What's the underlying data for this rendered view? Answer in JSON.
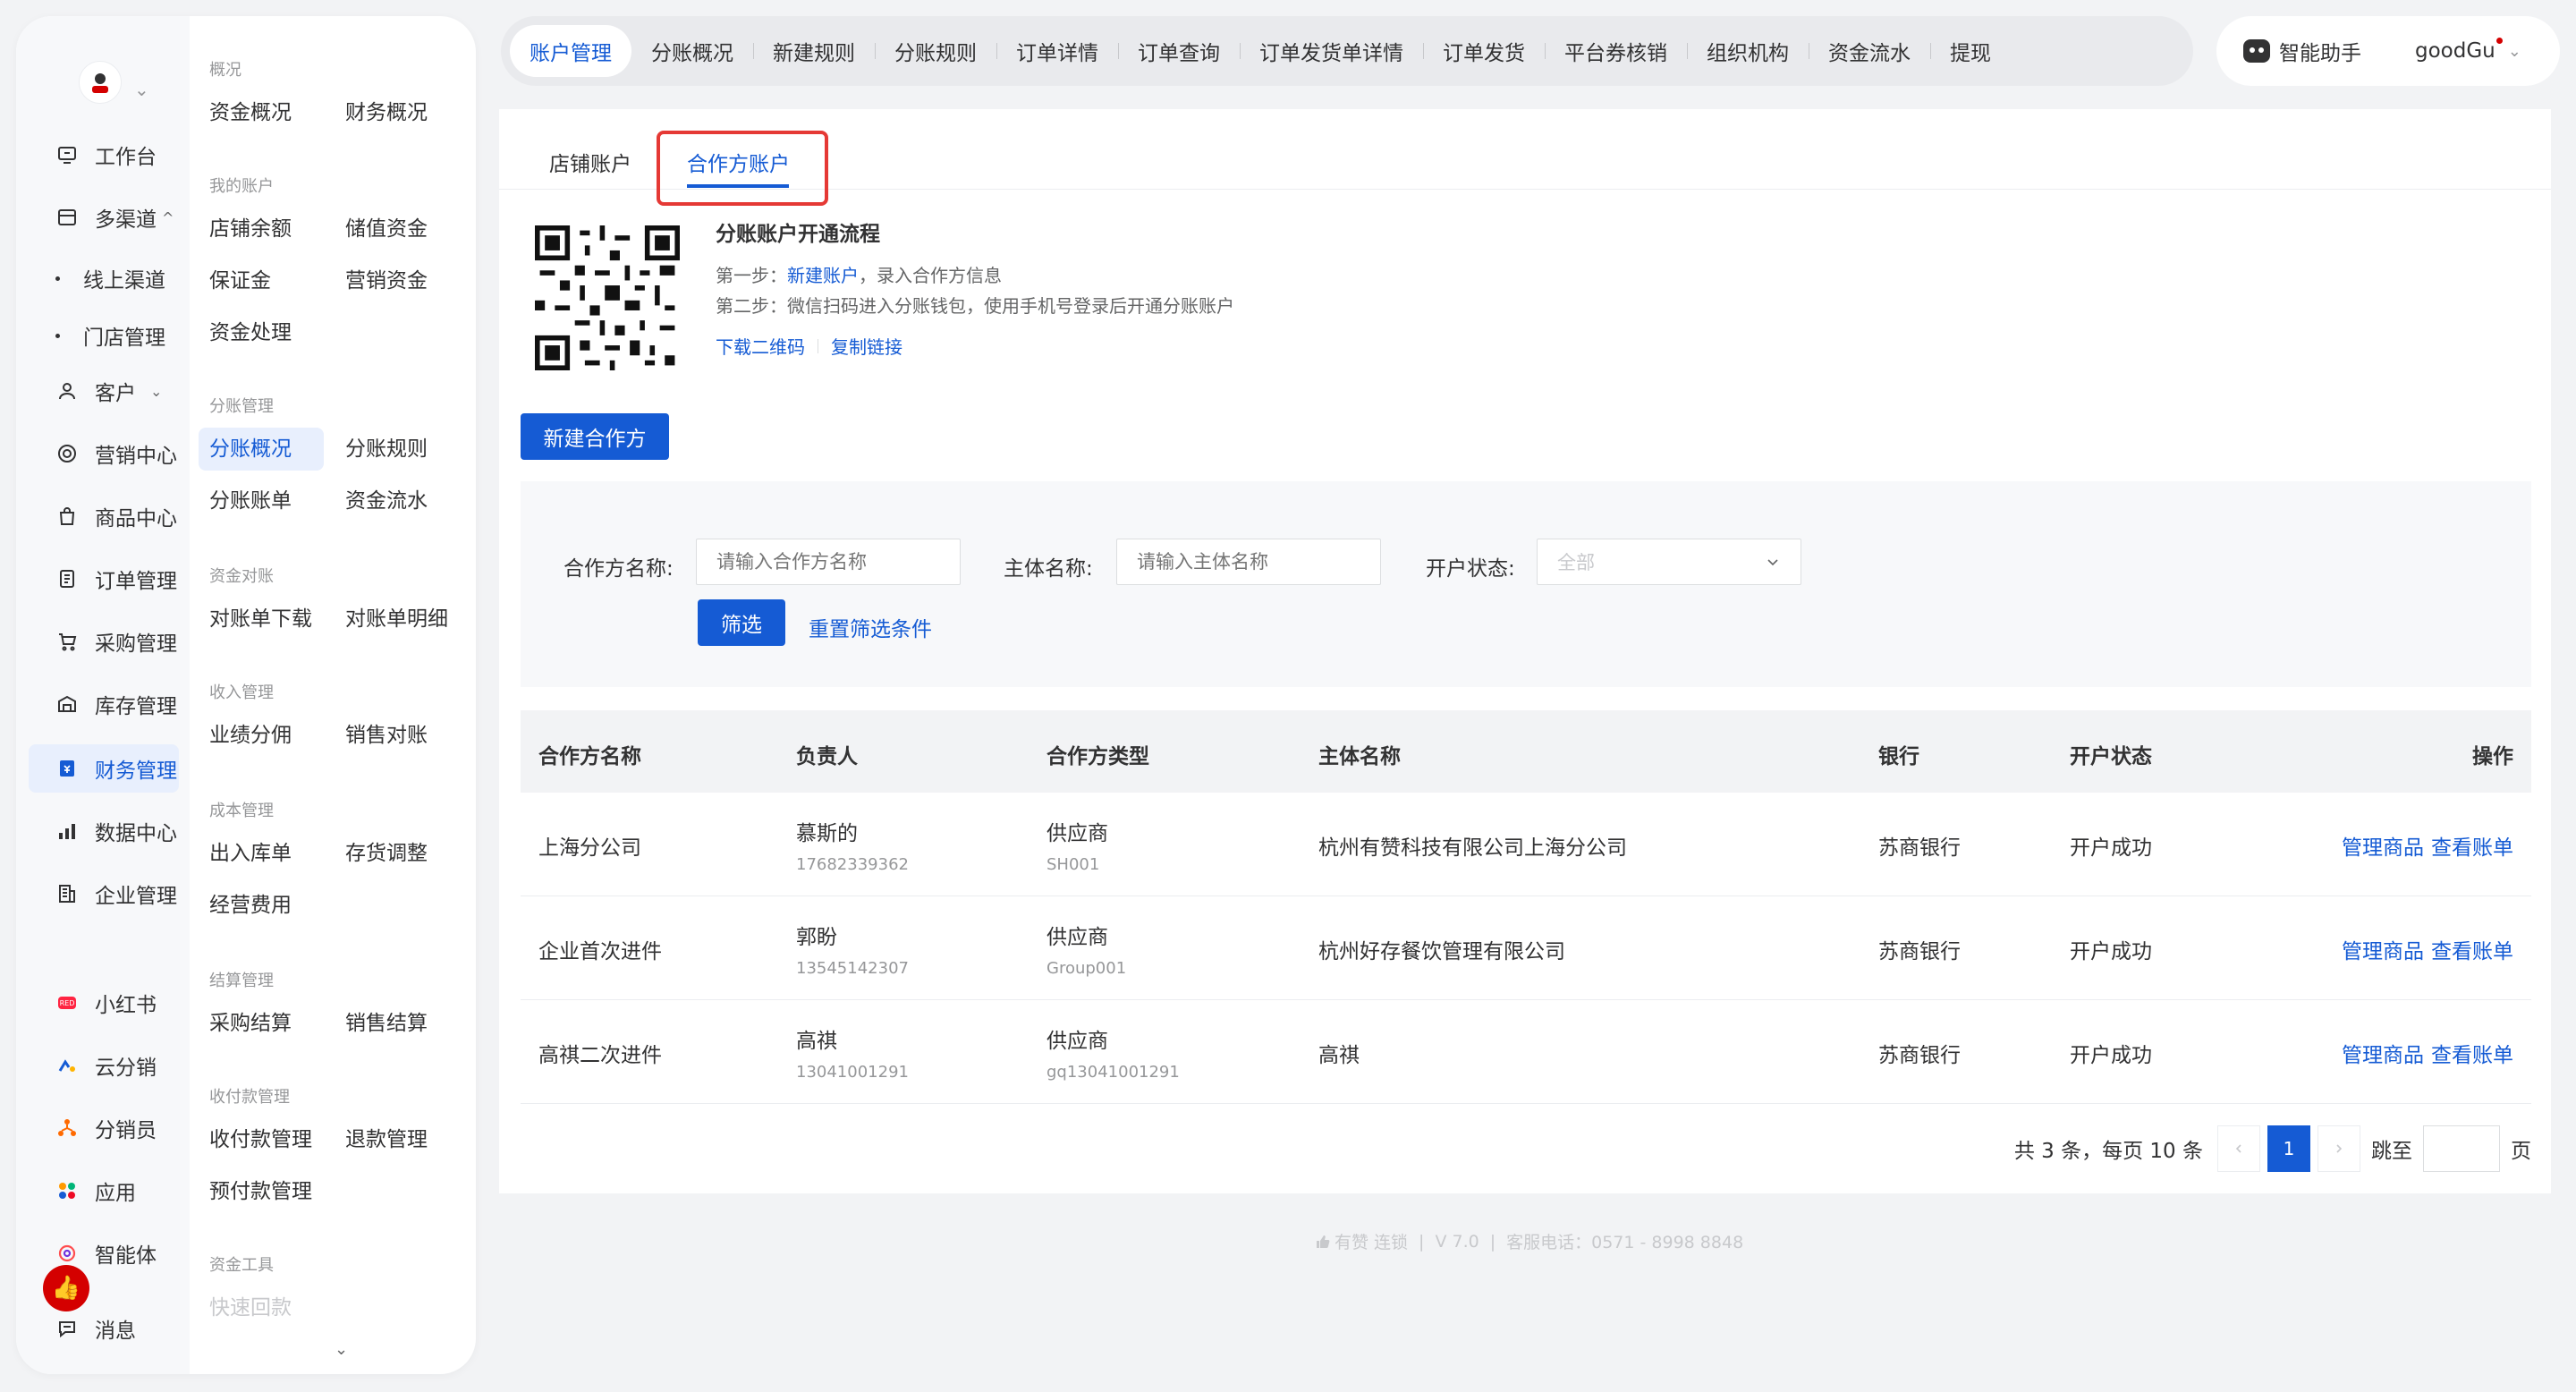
{
  "rail": {
    "items": [
      {
        "label": "工作台",
        "icon": "desk-icon"
      },
      {
        "label": "多渠道",
        "icon": "channel-icon"
      },
      {
        "label": "线上渠道"
      },
      {
        "label": "门店管理"
      },
      {
        "label": "客户",
        "icon": "user-icon"
      },
      {
        "label": "营销中心",
        "icon": "marketing-icon"
      },
      {
        "label": "商品中心",
        "icon": "bag-icon"
      },
      {
        "label": "订单管理",
        "icon": "order-icon"
      },
      {
        "label": "采购管理",
        "icon": "cart-icon"
      },
      {
        "label": "库存管理",
        "icon": "warehouse-icon"
      },
      {
        "label": "财务管理",
        "icon": "finance-icon"
      },
      {
        "label": "数据中心",
        "icon": "chart-icon"
      },
      {
        "label": "企业管理",
        "icon": "building-icon"
      },
      {
        "label": "小红书",
        "icon": "xiaohongshu-icon"
      },
      {
        "label": "云分销",
        "icon": "cloud-icon"
      },
      {
        "label": "分销员",
        "icon": "distributor-icon"
      },
      {
        "label": "应用",
        "icon": "apps-icon"
      },
      {
        "label": "智能体",
        "icon": "agent-icon"
      },
      {
        "label": "消息",
        "icon": "message-icon"
      }
    ],
    "caret_up": "^",
    "caret_down": "⌄"
  },
  "subnav": {
    "groups": [
      {
        "title": "概况",
        "links": [
          "资金概况",
          "财务概况"
        ]
      },
      {
        "title": "我的账户",
        "links": [
          "店铺余额",
          "储值资金",
          "保证金",
          "营销资金",
          "资金处理"
        ]
      },
      {
        "title": "分账管理",
        "links": [
          "分账概况",
          "分账规则",
          "分账账单",
          "资金流水"
        ]
      },
      {
        "title": "资金对账",
        "links": [
          "对账单下载",
          "对账单明细"
        ]
      },
      {
        "title": "收入管理",
        "links": [
          "业绩分佣",
          "销售对账"
        ]
      },
      {
        "title": "成本管理",
        "links": [
          "出入库单",
          "存货调整",
          "经营费用"
        ]
      },
      {
        "title": "结算管理",
        "links": [
          "采购结算",
          "销售结算"
        ]
      },
      {
        "title": "收付款管理",
        "links": [
          "收付款管理",
          "退款管理",
          "预付款管理"
        ]
      },
      {
        "title": "资金工具",
        "links": [
          "快速回款"
        ]
      }
    ]
  },
  "topbar": {
    "tabs": [
      "账户管理",
      "分账概况",
      "新建规则",
      "分账规则",
      "订单详情",
      "订单查询",
      "订单发货单详情",
      "订单发货",
      "平台券核销",
      "组织机构",
      "资金流水",
      "提现"
    ],
    "assistant": "智能助手",
    "user": "goodGu"
  },
  "subtabs": [
    "店铺账户",
    "合作方账户"
  ],
  "flow": {
    "title": "分账账户开通流程",
    "step1_prefix": "第一步：",
    "step1_link": "新建账户",
    "step1_suffix": "，录入合作方信息",
    "step2": "第二步：微信扫码进入分账钱包，使用手机号登录后开通分账账户",
    "download": "下载二维码",
    "copy": "复制链接"
  },
  "new_partner_button": "新建合作方",
  "filter": {
    "partner_label": "合作方名称:",
    "partner_placeholder": "请输入合作方名称",
    "entity_label": "主体名称:",
    "entity_placeholder": "请输入主体名称",
    "status_label": "开户状态:",
    "status_value": "全部",
    "submit": "筛选",
    "reset": "重置筛选条件"
  },
  "table": {
    "headers": [
      "合作方名称",
      "负责人",
      "合作方类型",
      "主体名称",
      "银行",
      "开户状态",
      "操作"
    ],
    "rows": [
      {
        "name": "上海分公司",
        "owner": "慕斯的",
        "phone": "17682339362",
        "type": "供应商",
        "code": "SH001",
        "entity": "杭州有赞科技有限公司上海分公司",
        "bank": "苏商银行",
        "status": "开户成功",
        "op1": "管理商品",
        "op2": "查看账单"
      },
      {
        "name": "企业首次进件",
        "owner": "郭盼",
        "phone": "13545142307",
        "type": "供应商",
        "code": "Group001",
        "entity": "杭州好存餐饮管理有限公司",
        "bank": "苏商银行",
        "status": "开户成功",
        "op1": "管理商品",
        "op2": "查看账单"
      },
      {
        "name": "高祺二次进件",
        "owner": "高祺",
        "phone": "13041001291",
        "type": "供应商",
        "code": "gq13041001291",
        "entity": "高祺",
        "bank": "苏商银行",
        "status": "开户成功",
        "op1": "管理商品",
        "op2": "查看账单"
      }
    ]
  },
  "pager": {
    "summary": "共 3 条，每页 10 条",
    "current": "1",
    "jump_label": "跳至",
    "page_unit": "页"
  },
  "footer": {
    "brand": "有赞 连锁",
    "version": "V 7.0",
    "phone": "客服电话：0571 - 8998 8848"
  },
  "colors": {
    "primary": "#155bd4",
    "highlight": "#e53935"
  }
}
